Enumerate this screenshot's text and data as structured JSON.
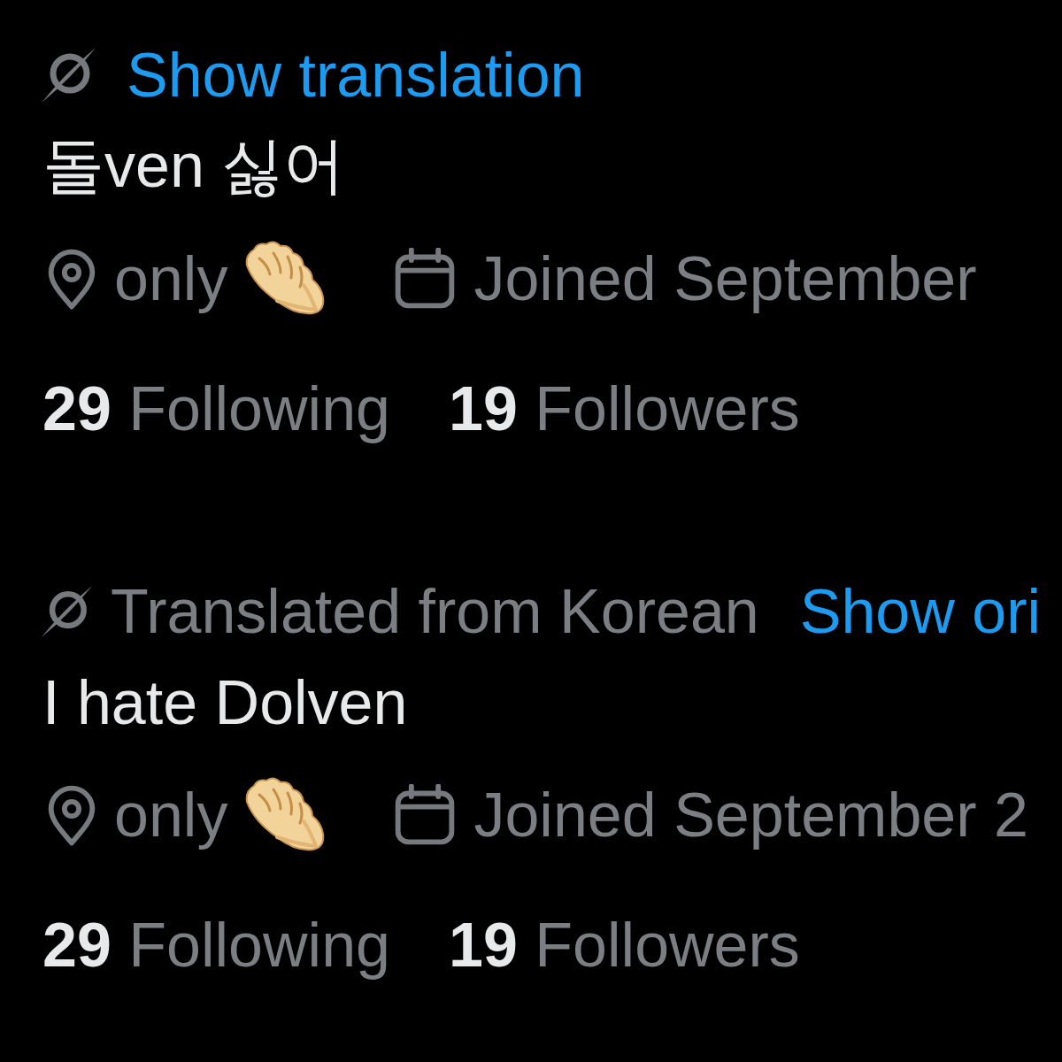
{
  "profiles": [
    {
      "translation": {
        "kind": "prompt",
        "link": "Show translation"
      },
      "bio": "돌ven 싫어",
      "location": "only",
      "joined": "Joined September",
      "stats": [
        "**29** Following",
        "**19** Followers"
      ]
    },
    {
      "translation": {
        "kind": "translated",
        "note": "Translated from Korean",
        "link": "Show ori"
      },
      "bio": "I hate Dolven",
      "location": "only",
      "joined": "Joined September 2",
      "stats": [
        "**29** Following",
        "**19** Followers"
      ]
    }
  ]
}
